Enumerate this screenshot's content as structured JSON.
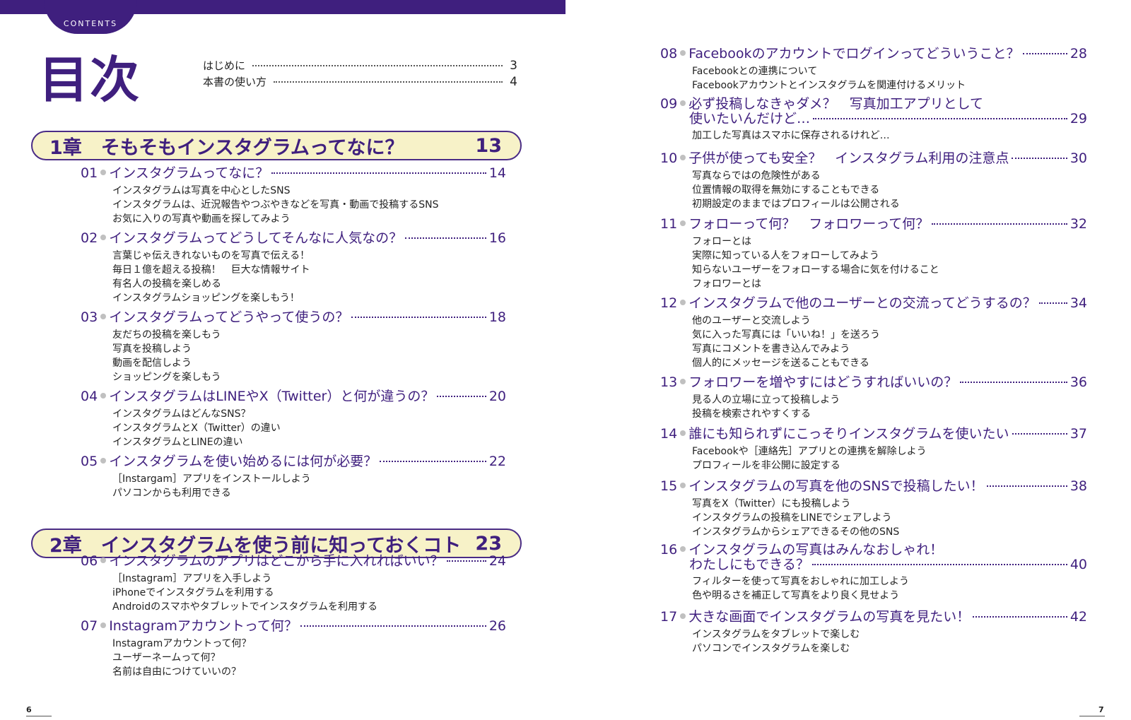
{
  "header": {
    "contents_label": "CONTENTS",
    "title": "目次"
  },
  "intro": [
    {
      "label": "はじめに",
      "page": "3"
    },
    {
      "label": "本書の使い方",
      "page": "4"
    }
  ],
  "chapters": [
    {
      "label": "1章　そもそもインスタグラムってなに？",
      "page": "13"
    },
    {
      "label": "2章　インスタグラムを使う前に知っておくコト",
      "page": "23"
    }
  ],
  "sections": [
    {
      "num": "01",
      "title": "インスタグラムってなに？",
      "title2": "",
      "page": "14",
      "subs": [
        "インスタグラムは写真を中心としたSNS",
        "インスタグラムは、近況報告やつぶやきなどを写真・動画で投稿するSNS",
        "お気に入りの写真や動画を探してみよう"
      ]
    },
    {
      "num": "02",
      "title": "インスタグラムってどうしてそんなに人気なの？",
      "title2": "",
      "page": "16",
      "subs": [
        "言葉じゃ伝えきれないものを写真で伝える！",
        "毎日１億を超える投稿！　巨大な情報サイト",
        "有名人の投稿を楽しめる",
        "インスタグラムショッピングを楽しもう！"
      ]
    },
    {
      "num": "03",
      "title": "インスタグラムってどうやって使うの？",
      "title2": "",
      "page": "18",
      "subs": [
        "友だちの投稿を楽しもう",
        "写真を投稿しよう",
        "動画を配信しよう",
        "ショッピングを楽しもう"
      ]
    },
    {
      "num": "04",
      "title": "インスタグラムはLINEやX（Twitter）と何が違うの？",
      "title2": "",
      "page": "20",
      "subs": [
        "インスタグラムはどんなSNS？",
        "インスタグラムとX（Twitter）の違い",
        "インスタグラムとLINEの違い"
      ]
    },
    {
      "num": "05",
      "title": "インスタグラムを使い始めるには何が必要？",
      "title2": "",
      "page": "22",
      "subs": [
        "［Instargam］アプリをインストールしよう",
        "パソコンからも利用できる"
      ]
    },
    {
      "num": "06",
      "title": "インスタグラムのアプリはどこから手に入れればいい？",
      "title2": "",
      "page": "24",
      "subs": [
        "［Instagram］アプリを入手しよう",
        "iPhoneでインスタグラムを利用する",
        "Androidのスマホやタブレットでインスタグラムを利用する"
      ]
    },
    {
      "num": "07",
      "title": "Instagramアカウントって何？",
      "title2": "",
      "page": "26",
      "subs": [
        "Instagramアカウントって何？",
        "ユーザーネームって何？",
        "名前は自由につけていいの？"
      ]
    },
    {
      "num": "08",
      "title": "Facebookのアカウントでログインってどういうこと？",
      "title2": "",
      "page": "28",
      "subs": [
        "Facebookとの連携について",
        "Facebookアカウントとインスタグラムを関連付けるメリット"
      ]
    },
    {
      "num": "09",
      "title": "必ず投稿しなきゃダメ？　写真加工アプリとして",
      "title2": "使いたいんだけど…",
      "page": "29",
      "subs": [
        "加工した写真はスマホに保存されるけれど…"
      ]
    },
    {
      "num": "10",
      "title": "子供が使っても安全？　インスタグラム利用の注意点",
      "title2": "",
      "page": "30",
      "subs": [
        "写真ならではの危険性がある",
        "位置情報の取得を無効にすることもできる",
        "初期設定のままではプロフィールは公開される"
      ]
    },
    {
      "num": "11",
      "title": "フォローって何？　フォロワーって何？",
      "title2": "",
      "page": "32",
      "subs": [
        "フォローとは",
        "実際に知っている人をフォローしてみよう",
        "知らないユーザーをフォローする場合に気を付けること",
        "フォロワーとは"
      ]
    },
    {
      "num": "12",
      "title": "インスタグラムで他のユーザーとの交流ってどうするの？",
      "title2": "",
      "page": "34",
      "subs": [
        "他のユーザーと交流しよう",
        "気に入った写真には「いいね！」を送ろう",
        "写真にコメントを書き込んでみよう",
        "個人的にメッセージを送ることもできる"
      ]
    },
    {
      "num": "13",
      "title": "フォロワーを増やすにはどうすればいいの？",
      "title2": "",
      "page": "36",
      "subs": [
        "見る人の立場に立って投稿しよう",
        "投稿を検索されやすくする"
      ]
    },
    {
      "num": "14",
      "title": "誰にも知られずにこっそりインスタグラムを使いたい",
      "title2": "",
      "page": "37",
      "subs": [
        "Facebookや［連絡先］アプリとの連携を解除しよう",
        "プロフィールを非公開に設定する"
      ]
    },
    {
      "num": "15",
      "title": "インスタグラムの写真を他のSNSで投稿したい！",
      "title2": "",
      "page": "38",
      "subs": [
        "写真をX（Twitter）にも投稿しよう",
        "インスタグラムの投稿をLINEでシェアしよう",
        "インスタグラムからシェアできるその他のSNS"
      ]
    },
    {
      "num": "16",
      "title": "インスタグラムの写真はみんなおしゃれ！",
      "title2": "わたしにもできる？",
      "page": "40",
      "subs": [
        "フィルターを使って写真をおしゃれに加工しよう",
        "色や明るさを補正して写真をより良く見せよう"
      ]
    },
    {
      "num": "17",
      "title": "大きな画面でインスタグラムの写真を見たい！",
      "title2": "",
      "page": "42",
      "subs": [
        "インスタグラムをタブレットで楽しむ",
        "パソコンでインスタグラムを楽しむ"
      ]
    }
  ],
  "footer": {
    "left_page": "6",
    "right_page": "7"
  }
}
